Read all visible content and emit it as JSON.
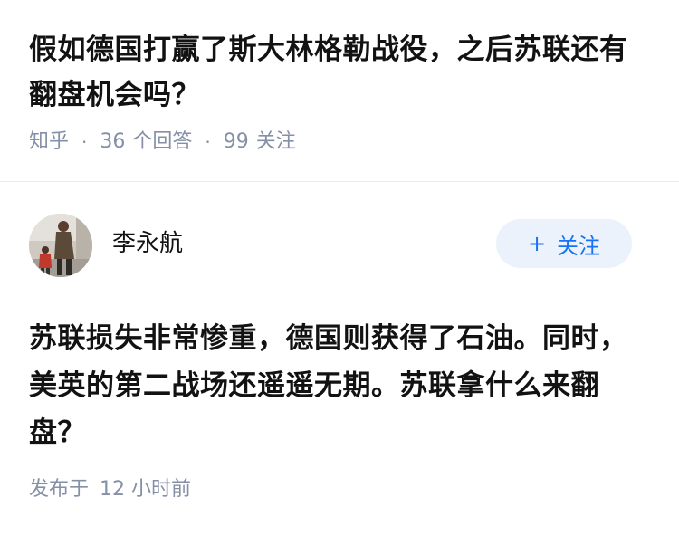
{
  "question": {
    "title": "假如德国打赢了斯大林格勒战役，之后苏联还有翻盘机会吗？",
    "source": "知乎",
    "answers_count": "36",
    "answers_label": "个回答",
    "followers_count": "99",
    "followers_label": "关注"
  },
  "author": {
    "name": "李永航",
    "follow_button": {
      "icon": "plus-icon",
      "label": "关注"
    }
  },
  "answer": {
    "text": "苏联损失非常惨重，德国则获得了石油。同时，美英的第二战场还遥遥无期。苏联拿什么来翻盘？",
    "published_label": "发布于",
    "published_time": "12 小时前"
  },
  "colors": {
    "accent": "#1772f6",
    "follow_bg": "#ebf2fb",
    "meta": "#8590a6",
    "text": "#121212"
  }
}
